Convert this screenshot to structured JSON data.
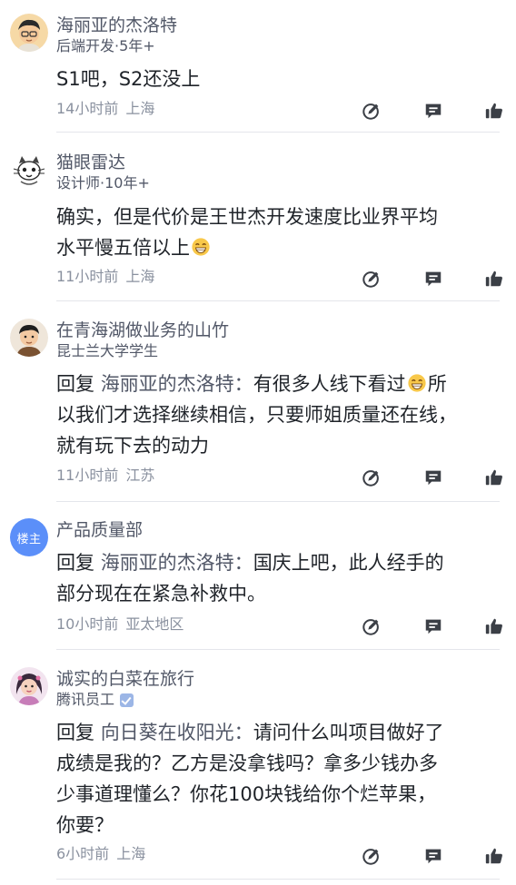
{
  "comments": [
    {
      "author": "海丽亚的杰洛特",
      "subtitle": "后端开发·5年+",
      "content": "S1吧，S2还没上",
      "time": "14小时前",
      "location": "上海"
    },
    {
      "author": "猫眼雷达",
      "subtitle": "设计师·10年+",
      "content_lines": [
        "确实，但是代价是王世杰开发速度比业界平均",
        "水平慢五倍以上"
      ],
      "time": "11小时前",
      "location": "上海"
    },
    {
      "author": "在青海湖做业务的山竹",
      "subtitle": "昆士兰大学学生",
      "reply_prefix": "回复",
      "reply_target": "海丽亚的杰洛特：",
      "content_lines": [
        "有很多人线下看过",
        "所",
        "以我们才选择继续相信，只要师姐质量还在线，",
        "就有玩下去的动力"
      ],
      "time": "11小时前",
      "location": "江苏"
    },
    {
      "author": "产品质量部",
      "avatar_badge": "楼主",
      "reply_prefix": "回复",
      "reply_target": "海丽亚的杰洛特：",
      "content_lines": [
        "国庆上吧，此人经手的",
        "部分现在在紧急补救中。"
      ],
      "time": "10小时前",
      "location": "亚太地区"
    },
    {
      "author": "诚实的白菜在旅行",
      "subtitle": "腾讯员工",
      "reply_prefix": "回复",
      "reply_target": "向日葵在收阳光：",
      "content_lines": [
        "请问什么叫项目做好了",
        "成绩是我的？乙方是没拿钱吗？拿多少钱办多",
        "少事道理懂么？你花100块钱给你个烂苹果，",
        "你要？"
      ],
      "time": "6小时前",
      "location": "上海"
    }
  ],
  "icons": {
    "annotate": "edit-circle-icon",
    "comment": "comment-bubble-icon",
    "like": "thumbs-up-icon",
    "emoji": "grin-emoji-icon"
  },
  "colors": {
    "text_primary": "#1f2329",
    "text_secondary": "#515767",
    "text_muted": "#8a919f",
    "owner_badge": "#5b8ff9",
    "icon": "#3b3f46"
  }
}
